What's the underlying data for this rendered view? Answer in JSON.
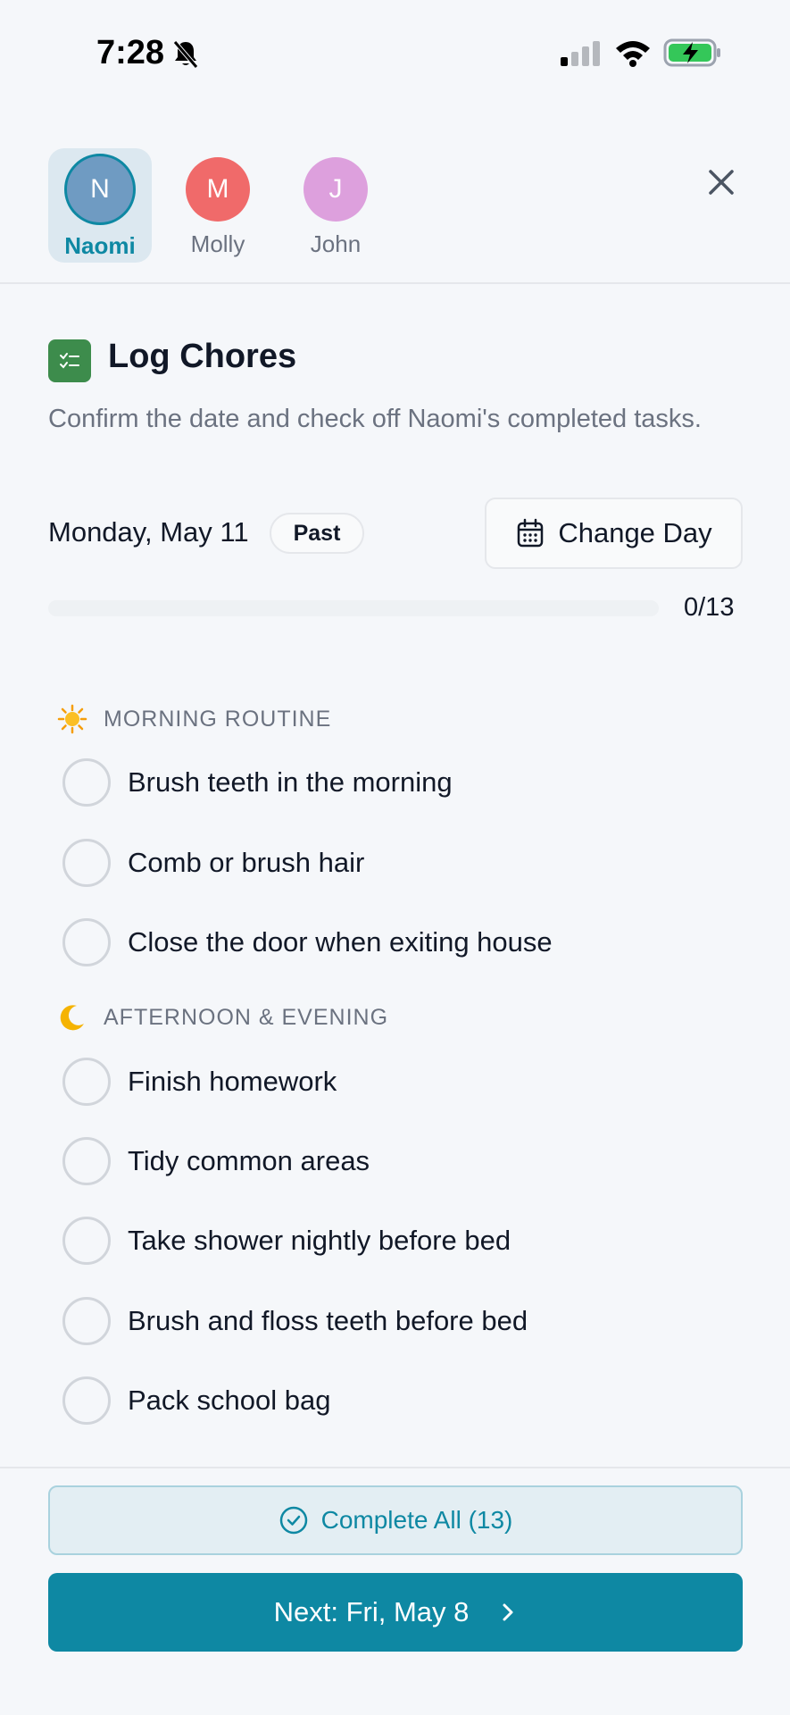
{
  "status_bar": {
    "time": "7:28"
  },
  "profiles": [
    {
      "initial": "N",
      "name": "Naomi",
      "active": true,
      "color": "#6F9BC2"
    },
    {
      "initial": "M",
      "name": "Molly",
      "active": false,
      "color": "#F06A6A"
    },
    {
      "initial": "J",
      "name": "John",
      "active": false,
      "color": "#DDA0DD"
    }
  ],
  "header": {
    "title": "Log Chores",
    "subtitle": "Confirm the date and check off Naomi's completed tasks."
  },
  "date": {
    "label": "Monday, May 11",
    "badge": "Past",
    "change_day_label": "Change Day"
  },
  "progress": {
    "count_text": "0/13",
    "completed": 0,
    "total": 13
  },
  "sections": [
    {
      "emoji": "sun",
      "title": "MORNING ROUTINE",
      "tasks": [
        "Brush teeth in the morning",
        "Comb or brush hair",
        "Close the door when exiting house"
      ]
    },
    {
      "emoji": "moon",
      "title": "AFTERNOON & EVENING",
      "tasks": [
        "Finish homework",
        "Tidy common areas",
        "Take shower nightly before bed",
        "Brush and floss teeth before bed",
        "Pack school bag"
      ]
    }
  ],
  "actions": {
    "complete_all_label": "Complete All (13)",
    "next_label": "Next: Fri, May 8"
  },
  "colors": {
    "accent": "#0E88A3",
    "title_icon": "#3D8C4C",
    "background": "#F5F7FA"
  }
}
